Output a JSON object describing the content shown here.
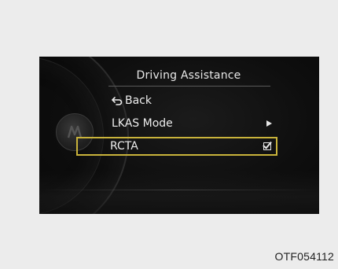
{
  "menu": {
    "title": "Driving Assistance",
    "items": [
      {
        "label": "Back",
        "icon": "back-arrow-icon"
      },
      {
        "label": "LKAS Mode",
        "icon": "submenu-arrow-icon"
      },
      {
        "label": "RCTA",
        "icon": "checkbox-icon",
        "checked": true,
        "selected": true
      }
    ]
  },
  "figure": {
    "code": "OTF054112"
  },
  "colors": {
    "background": "#ececec",
    "display": "#0e0e0e",
    "highlight": "#c9b33b",
    "text": "#ededed"
  }
}
